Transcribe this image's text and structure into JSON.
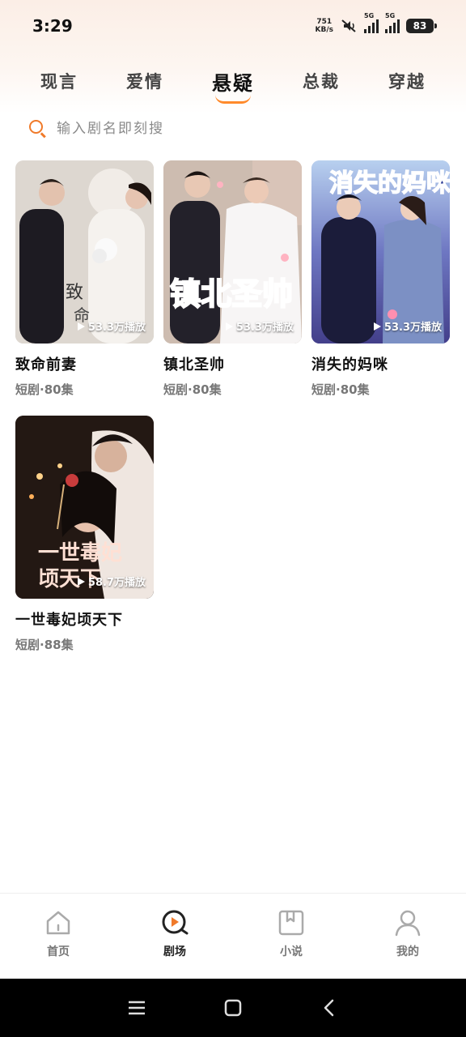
{
  "status": {
    "time": "3:29",
    "net_speed_value": "751",
    "net_speed_unit": "KB/s",
    "signal_1": "5G",
    "signal_2": "5G",
    "battery": "83"
  },
  "tabs": [
    {
      "label": "现言"
    },
    {
      "label": "爱情"
    },
    {
      "label": "悬疑"
    },
    {
      "label": "总裁"
    },
    {
      "label": "穿越"
    }
  ],
  "active_tab": "悬疑",
  "search": {
    "placeholder": "输入剧名即刻搜"
  },
  "cards": [
    {
      "title": "致命前妻",
      "meta": "短剧·80集",
      "plays": "53.3万播放",
      "poster_text": "致命前妻"
    },
    {
      "title": "镇北圣帅",
      "meta": "短剧·80集",
      "plays": "53.3万播放",
      "poster_text": "镇北圣帅"
    },
    {
      "title": "消失的妈咪",
      "meta": "短剧·80集",
      "plays": "53.3万播放",
      "poster_text": "消失的妈咪"
    },
    {
      "title": "一世毒妃顷天下",
      "meta": "短剧·88集",
      "plays": "58.7万播放",
      "poster_text": "一世毒妃顷天下"
    }
  ],
  "bottom_nav": [
    {
      "label": "首页",
      "icon": "home-icon"
    },
    {
      "label": "剧场",
      "icon": "theater-play-icon"
    },
    {
      "label": "小说",
      "icon": "book-icon"
    },
    {
      "label": "我的",
      "icon": "user-icon"
    }
  ],
  "colors": {
    "accent": "#f07a2a",
    "active_underline": "#ff8a2b"
  }
}
